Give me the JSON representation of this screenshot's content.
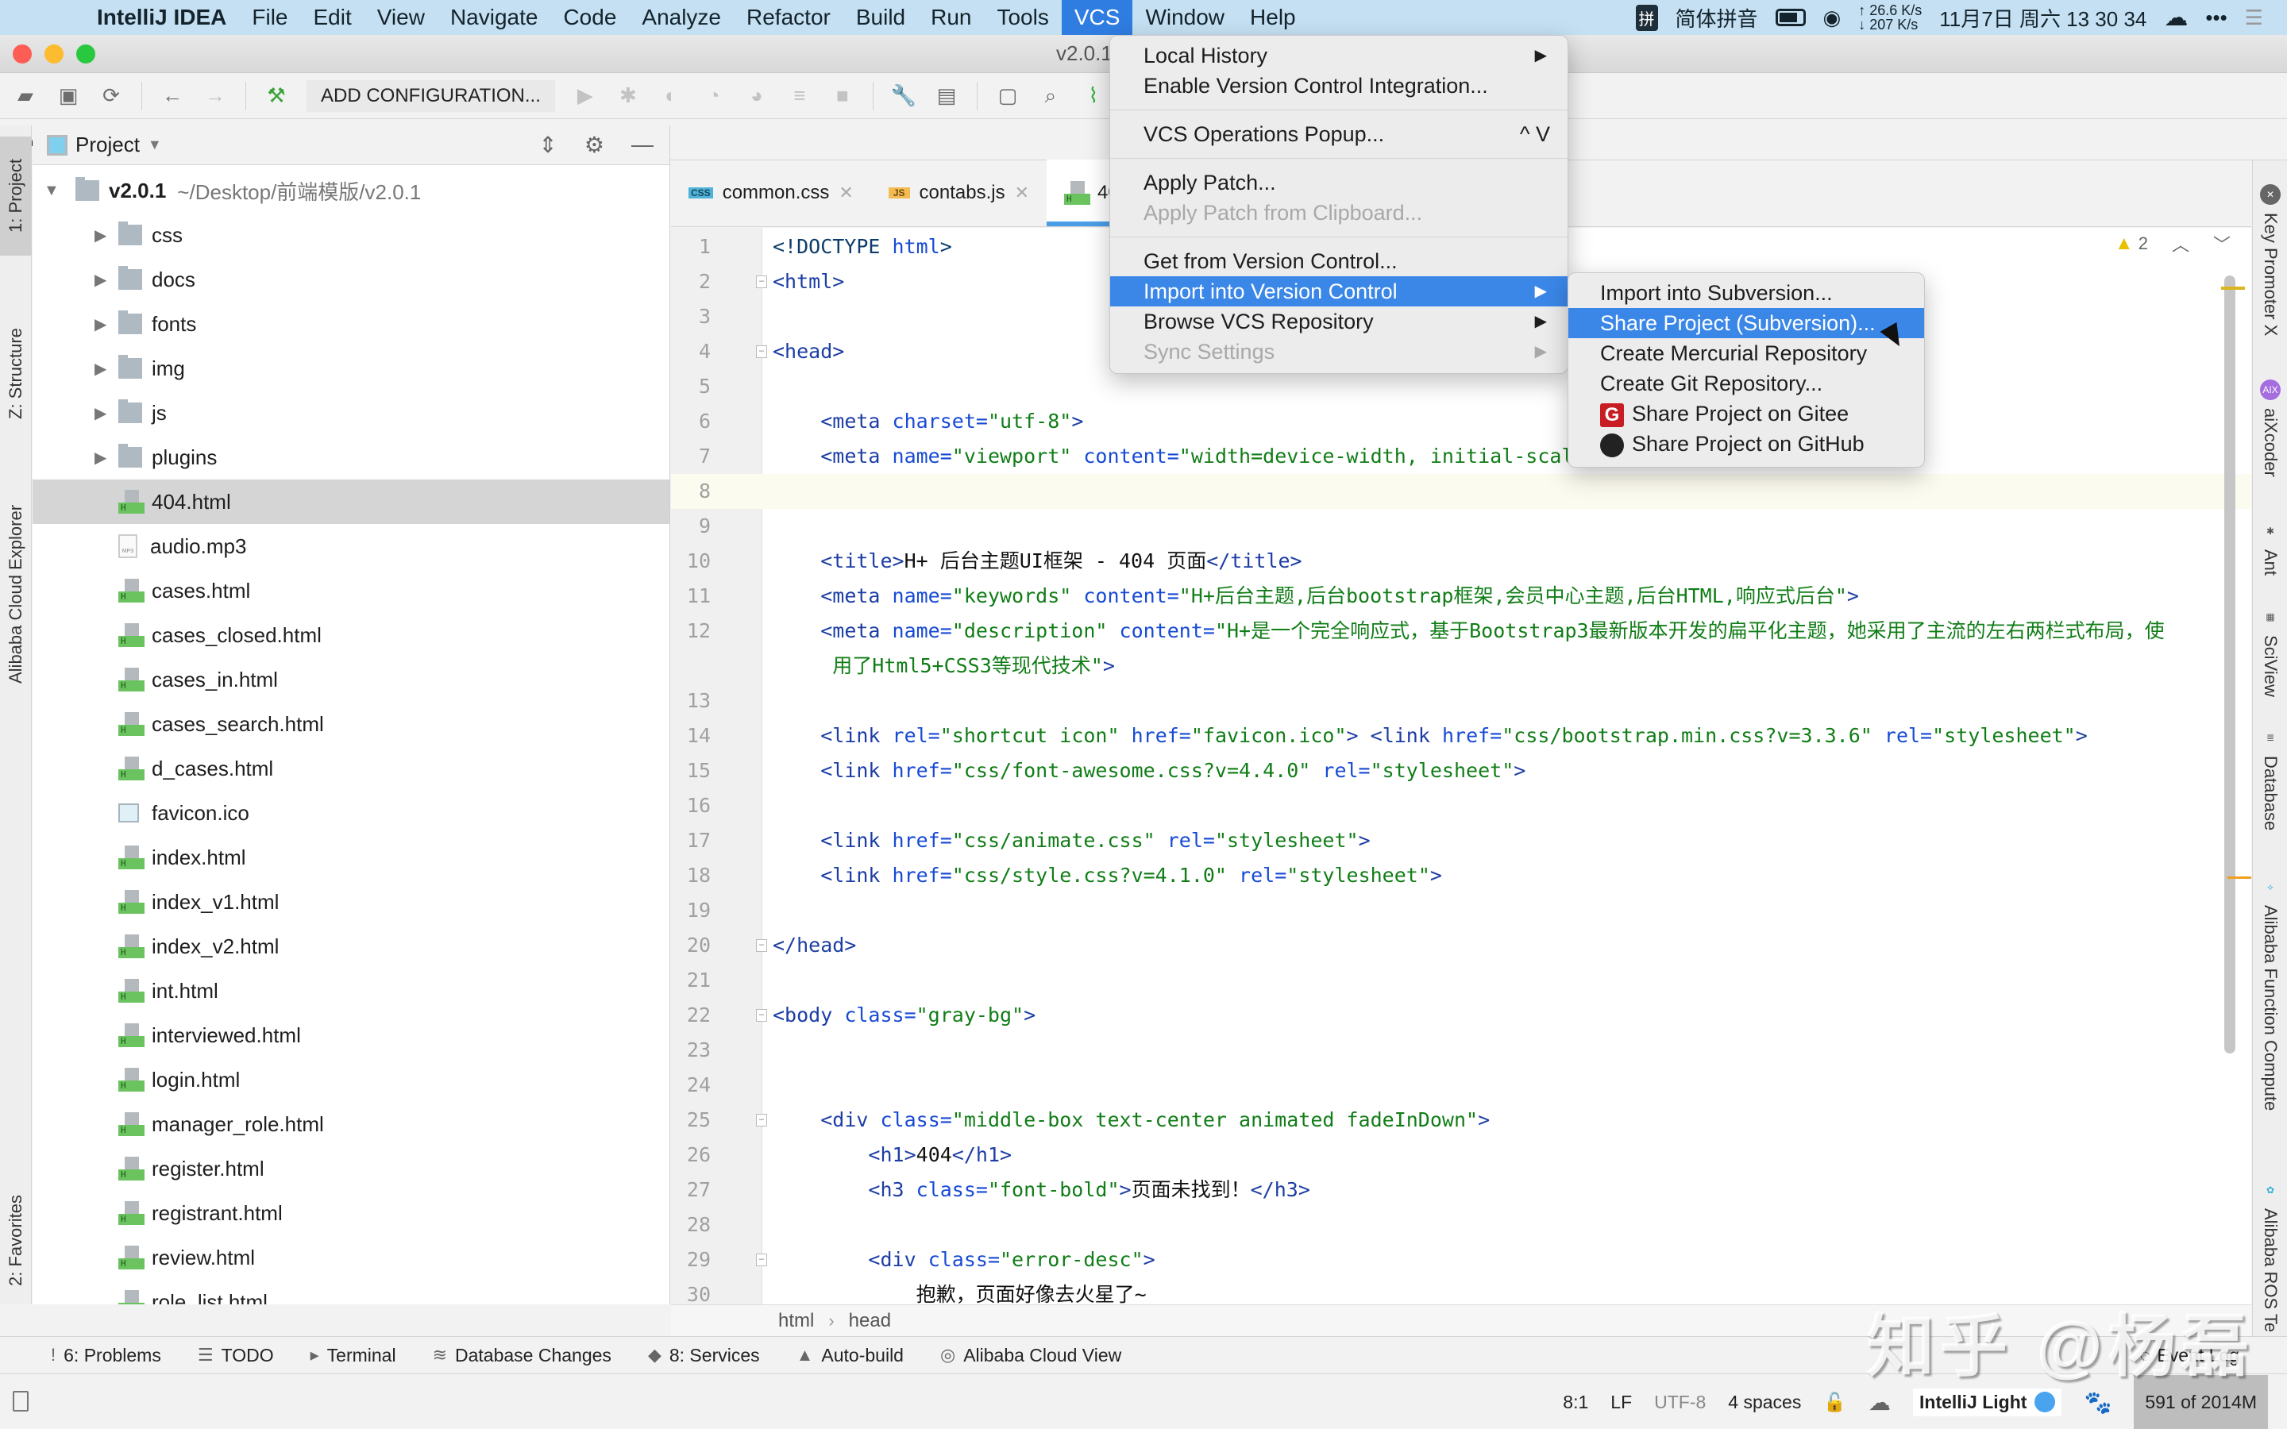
{
  "menubar": {
    "app": "IntelliJ IDEA",
    "items": [
      "File",
      "Edit",
      "View",
      "Navigate",
      "Code",
      "Analyze",
      "Refactor",
      "Build",
      "Run",
      "Tools",
      "VCS",
      "Window",
      "Help"
    ],
    "active": "VCS",
    "ime_badge": "拼",
    "ime": "简体拼音",
    "net_up": "↑ 26.6 K/s",
    "net_down": "↓ 207 K/s",
    "datetime": "11月7日 周六  13 30 34"
  },
  "window": {
    "title": "v2.0.1"
  },
  "toolbar": {
    "add_config": "ADD CONFIGURATION..."
  },
  "navbar": {
    "root": "v2.0.1",
    "file": "404.html"
  },
  "left_strip": {
    "project": "1: Project",
    "structure": "Z: Structure",
    "cloud": "Alibaba Cloud Explorer",
    "favorites": "2: Favorites"
  },
  "project": {
    "title": "Project",
    "root_name": "v2.0.1",
    "root_path": "~/Desktop/前端模版/v2.0.1",
    "folders": [
      "css",
      "docs",
      "fonts",
      "img",
      "js",
      "plugins"
    ],
    "files": [
      {
        "name": "404.html",
        "type": "html",
        "selected": true
      },
      {
        "name": "audio.mp3",
        "type": "mp3"
      },
      {
        "name": "cases.html",
        "type": "html"
      },
      {
        "name": "cases_closed.html",
        "type": "html"
      },
      {
        "name": "cases_in.html",
        "type": "html"
      },
      {
        "name": "cases_search.html",
        "type": "html"
      },
      {
        "name": "d_cases.html",
        "type": "html"
      },
      {
        "name": "favicon.ico",
        "type": "ico"
      },
      {
        "name": "index.html",
        "type": "html"
      },
      {
        "name": "index_v1.html",
        "type": "html"
      },
      {
        "name": "index_v2.html",
        "type": "html"
      },
      {
        "name": "int.html",
        "type": "html"
      },
      {
        "name": "interviewed.html",
        "type": "html"
      },
      {
        "name": "login.html",
        "type": "html"
      },
      {
        "name": "manager_role.html",
        "type": "html"
      },
      {
        "name": "register.html",
        "type": "html"
      },
      {
        "name": "registrant.html",
        "type": "html"
      },
      {
        "name": "review.html",
        "type": "html"
      },
      {
        "name": "role_list.html",
        "type": "html"
      }
    ]
  },
  "tabs": [
    {
      "label": "common.css",
      "badge": "CSS"
    },
    {
      "label": "contabs.js",
      "badge": "JS"
    },
    {
      "label": "404.html",
      "badge": "H",
      "active": true
    }
  ],
  "editor": {
    "warnings": "2",
    "lines": [
      {
        "n": "1",
        "html": "<span class='doc'>&lt;!DOCTYPE </span><span class='att'>html</span><span class='doc'>&gt;</span>"
      },
      {
        "n": "2",
        "html": "<span class='tag'>&lt;html&gt;</span>",
        "fold": true
      },
      {
        "n": "3",
        "html": ""
      },
      {
        "n": "4",
        "html": "<span class='tag'>&lt;head&gt;</span>",
        "fold": true
      },
      {
        "n": "5",
        "html": ""
      },
      {
        "n": "6",
        "html": "    <span class='tag'>&lt;meta </span><span class='att'>charset=</span><span class='val'>\"utf-8\"</span><span class='tag'>&gt;</span>"
      },
      {
        "n": "7",
        "html": "    <span class='tag'>&lt;meta </span><span class='att'>name=</span><span class='val'>\"viewport\"</span> <span class='att'>content=</span><span class='val'>\"width=device-width, initial-scale=1.0\"</span><span class='tag'>&gt;</span>"
      },
      {
        "n": "8",
        "html": "",
        "current": true
      },
      {
        "n": "9",
        "html": ""
      },
      {
        "n": "10",
        "html": "    <span class='tag'>&lt;title&gt;</span><span class='txt'>H+ 后台主题UI框架 - 404 页面</span><span class='tag'>&lt;/title&gt;</span>"
      },
      {
        "n": "11",
        "html": "    <span class='tag'>&lt;meta </span><span class='att'>name=</span><span class='val'>\"keywords\"</span> <span class='att'>content=</span><span class='val'>\"H+后台主题,后台bootstrap框架,会员中心主题,后台HTML,响应式后台\"</span><span class='tag'>&gt;</span>"
      },
      {
        "n": "12",
        "html": "    <span class='tag'>&lt;meta </span><span class='att'>name=</span><span class='val'>\"description\"</span> <span class='att'>content=</span><span class='val'>\"H+是一个完全响应式，基于Bootstrap3最新版本开发的扁平化主题，她采用了主流的左右两栏式布局，使</span>"
      },
      {
        "n": "",
        "html": "     <span class='val'>用了Html5+CSS3等现代技术\"</span><span class='tag'>&gt;</span>"
      },
      {
        "n": "13",
        "html": ""
      },
      {
        "n": "14",
        "html": "    <span class='tag'>&lt;link </span><span class='att'>rel=</span><span class='val'>\"shortcut icon\"</span> <span class='att'>href=</span><span class='val'>\"favicon.ico\"</span><span class='tag'>&gt;</span> <span class='tag'>&lt;link </span><span class='att'>href=</span><span class='val'>\"css/bootstrap.min.css?v=3.3.6\"</span> <span class='att'>rel=</span><span class='val'>\"stylesheet\"</span><span class='tag'>&gt;</span>"
      },
      {
        "n": "15",
        "html": "    <span class='tag'>&lt;link </span><span class='att'>href=</span><span class='val'>\"css/font-awesome.css?v=4.4.0\"</span> <span class='att'>rel=</span><span class='val'>\"stylesheet\"</span><span class='tag'>&gt;</span>"
      },
      {
        "n": "16",
        "html": ""
      },
      {
        "n": "17",
        "html": "    <span class='tag'>&lt;link </span><span class='att'>href=</span><span class='val'>\"css/animate.css\"</span> <span class='att'>rel=</span><span class='val'>\"stylesheet\"</span><span class='tag'>&gt;</span>"
      },
      {
        "n": "18",
        "html": "    <span class='tag'>&lt;link </span><span class='att'>href=</span><span class='val'>\"css/style.css?v=4.1.0\"</span> <span class='att'>rel=</span><span class='val'>\"stylesheet\"</span><span class='tag'>&gt;</span>"
      },
      {
        "n": "19",
        "html": ""
      },
      {
        "n": "20",
        "html": "<span class='tag'>&lt;/head&gt;</span>",
        "fold": true
      },
      {
        "n": "21",
        "html": ""
      },
      {
        "n": "22",
        "html": "<span class='tag'>&lt;body </span><span class='att'>class=</span><span class='val'>\"gray-bg\"</span><span class='tag'>&gt;</span>",
        "fold": true
      },
      {
        "n": "23",
        "html": ""
      },
      {
        "n": "24",
        "html": ""
      },
      {
        "n": "25",
        "html": "    <span class='tag'>&lt;div </span><span class='att'>class=</span><span class='val'>\"middle-box text-center animated fadeInDown\"</span><span class='tag'>&gt;</span>",
        "fold": true
      },
      {
        "n": "26",
        "html": "        <span class='tag'>&lt;h1&gt;</span><span class='txt'>404</span><span class='tag'>&lt;/h1&gt;</span>"
      },
      {
        "n": "27",
        "html": "        <span class='tag'>&lt;h3 </span><span class='att'>class=</span><span class='val'>\"font-bold\"</span><span class='tag'>&gt;</span><span class='txt'>页面未找到！</span><span class='tag'>&lt;/h3&gt;</span>"
      },
      {
        "n": "28",
        "html": ""
      },
      {
        "n": "29",
        "html": "        <span class='tag'>&lt;div </span><span class='att'>class=</span><span class='val'>\"error-desc\"</span><span class='tag'>&gt;</span>",
        "fold": true
      },
      {
        "n": "30",
        "html": "            <span class='txt'>抱歉，页面好像去火星了~</span>"
      }
    ],
    "crumbs": [
      "html",
      "head"
    ]
  },
  "right_strip": [
    "Key Promoter X",
    "aiXcoder",
    "Ant",
    "SciView",
    "Database",
    "Alibaba Function Compute",
    "Alibaba ROS Te"
  ],
  "bottom_tools": [
    {
      "icon": "problems-icon",
      "glyph": "!",
      "label": "6: Problems"
    },
    {
      "icon": "todo-icon",
      "glyph": "☰",
      "label": "TODO"
    },
    {
      "icon": "terminal-icon",
      "glyph": "▸",
      "label": "Terminal"
    },
    {
      "icon": "database-changes-icon",
      "glyph": "≋",
      "label": "Database Changes"
    },
    {
      "icon": "services-icon",
      "glyph": "◆",
      "label": "8: Services"
    },
    {
      "icon": "auto-build-icon",
      "glyph": "▲",
      "label": "Auto-build"
    },
    {
      "icon": "alibaba-cloud-icon",
      "glyph": "◎",
      "label": "Alibaba Cloud View"
    }
  ],
  "event_log": "Event Log",
  "status": {
    "position": "8:1",
    "line_sep": "LF",
    "encoding": "UTF-8",
    "indent": "4 spaces",
    "theme": "IntelliJ Light",
    "memory": "591 of 2014M"
  },
  "vcs_menu": {
    "items": [
      {
        "label": "Local History",
        "submenu": true
      },
      {
        "label": "Enable Version Control Integration..."
      },
      {
        "sep": true
      },
      {
        "label": "VCS Operations Popup...",
        "shortcut": "^ V"
      },
      {
        "sep": true
      },
      {
        "label": "Apply Patch..."
      },
      {
        "label": "Apply Patch from Clipboard...",
        "disabled": true
      },
      {
        "sep": true
      },
      {
        "label": "Get from Version Control..."
      },
      {
        "label": "Import into Version Control",
        "submenu": true,
        "highlighted": true
      },
      {
        "label": "Browse VCS Repository",
        "submenu": true
      },
      {
        "label": "Sync Settings",
        "submenu": true,
        "disabled": true
      }
    ]
  },
  "import_submenu": {
    "items": [
      {
        "label": "Import into Subversion..."
      },
      {
        "label": "Share Project (Subversion)...",
        "highlighted": true
      },
      {
        "label": "Create Mercurial Repository"
      },
      {
        "label": "Create Git Repository..."
      },
      {
        "label": "Share Project on Gitee",
        "icon": "gitee"
      },
      {
        "label": "Share Project on GitHub",
        "icon": "github"
      }
    ]
  },
  "watermark": "知乎 @杨磊"
}
